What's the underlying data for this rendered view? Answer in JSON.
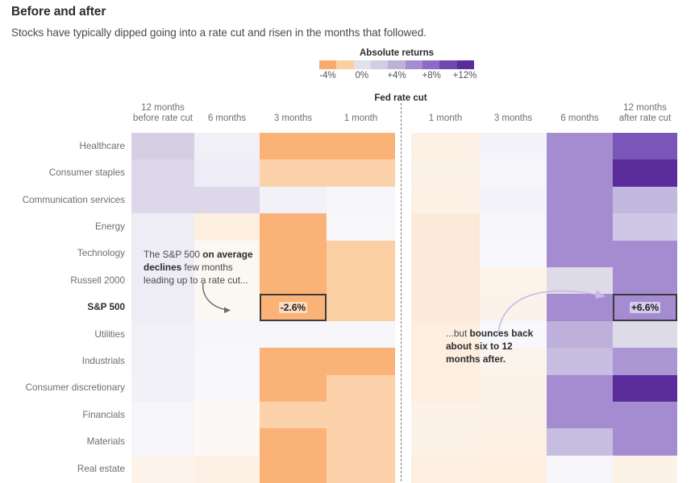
{
  "header": {
    "title": "Before and after",
    "subtitle": "Stocks have typically dipped going into a rate cut and risen in the months that followed."
  },
  "legend": {
    "title": "Absolute returns",
    "swatches": [
      "#f8ac6b",
      "#fbcfa4",
      "#e2e0ea",
      "#d3cde4",
      "#bdb0da",
      "#a58cd0",
      "#8d6bc4",
      "#6f49b0",
      "#5b2d9c"
    ],
    "ticks": [
      {
        "label": "-4%",
        "pos_pct": 5.5
      },
      {
        "label": "0%",
        "pos_pct": 27.5
      },
      {
        "label": "+4%",
        "pos_pct": 50.0
      },
      {
        "label": "+8%",
        "pos_pct": 72.5
      },
      {
        "label": "+12%",
        "pos_pct": 94.0
      }
    ]
  },
  "chart_data": {
    "type": "heatmap",
    "title": "Before and after",
    "subtitle": "Stocks have typically dipped going into a rate cut and risen in the months that followed.",
    "colorbar_label": "Absolute returns",
    "divider_label": "Fed rate cut",
    "xlabel": "",
    "ylabel": "",
    "categories": [
      "12 months\nbefore rate cut",
      "6 months",
      "3 months",
      "1 month",
      "1 month",
      "3 months",
      "6 months",
      "12 months\nafter rate cut"
    ],
    "column_headers": [
      {
        "line1": "12 months",
        "line2": "before rate cut"
      },
      {
        "line1": "6 months",
        "line2": ""
      },
      {
        "line1": "3 months",
        "line2": ""
      },
      {
        "line1": "1 month",
        "line2": ""
      },
      {
        "line1": "1 month",
        "line2": ""
      },
      {
        "line1": "3 months",
        "line2": ""
      },
      {
        "line1": "6 months",
        "line2": ""
      },
      {
        "line1": "12 months",
        "line2": "after rate cut"
      }
    ],
    "rows": [
      "Healthcare",
      "Consumer staples",
      "Communication services",
      "Energy",
      "Technology",
      "Russell 2000",
      "S&P 500",
      "Utilities",
      "Industrials",
      "Consumer discretionary",
      "Financials",
      "Materials",
      "Real estate"
    ],
    "emphasized_row": "S&P 500",
    "colors": [
      [
        "#d6cfe3",
        "#f1f0f7",
        "#fbb277",
        "#fbb277",
        "#fdf0e4",
        "#f4f3f9",
        "#a58cd0",
        "#7a56b8"
      ],
      [
        "#dcd7e9",
        "#eeecf6",
        "#fcd2ab",
        "#fcd2ab",
        "#fbf1e6",
        "#f7f6fb",
        "#a58cd0",
        "#5b2d9c"
      ],
      [
        "#dcd7e9",
        "#dcd7e9",
        "#f2f1f8",
        "#f7f7fb",
        "#fdf0e4",
        "#f4f3f9",
        "#a58cd0",
        "#c3b8de"
      ],
      [
        "#eeedf5",
        "#fdefdf",
        "#fbb277",
        "#f8f8fb",
        "#fbe9da",
        "#f6f5fa",
        "#a58cd0",
        "#cfc7e5"
      ],
      [
        "#eeedf5",
        "#fbf7f3",
        "#fbb277",
        "#fbcfa4",
        "#fbe9da",
        "#f8f7fb",
        "#a58cd0",
        "#a58cd0"
      ],
      [
        "#eeedf5",
        "#fbf7f3",
        "#fbb277",
        "#fbcfa4",
        "#fbe9da",
        "#fdf3e8",
        "#dedbe9",
        "#a58cd0"
      ],
      [
        "#eeedf5",
        "#fbf7f3",
        "#fbb277",
        "#fbcfa4",
        "#fbe9da",
        "#fbf3ea",
        "#a58cd0",
        "#a58cd0"
      ],
      [
        "#f1f0f7",
        "#f7f6fa",
        "#f7f7fb",
        "#f7f7fb",
        "#fdeee0",
        "#f8f8fc",
        "#bdb0da",
        "#dedbe9"
      ],
      [
        "#f1f0f7",
        "#f8f7fb",
        "#fbb277",
        "#fbb277",
        "#fdeee0",
        "#fbf4ec",
        "#c6bde1",
        "#ac95d3"
      ],
      [
        "#f2f1f8",
        "#f8f7fb",
        "#fbb277",
        "#fcd2ab",
        "#fdeee0",
        "#fdf2e7",
        "#a58cd0",
        "#5b2d9c"
      ],
      [
        "#f6f5fa",
        "#fbf8f5",
        "#fcd2ab",
        "#fcd2ab",
        "#fdf2e7",
        "#fbf1e6",
        "#a58cd0",
        "#a58cd0"
      ],
      [
        "#f6f5fa",
        "#fbf8f5",
        "#fbb277",
        "#fcd2ab",
        "#fdf2e7",
        "#fdf0e4",
        "#c6bde1",
        "#a58cd0"
      ],
      [
        "#fdf3ea",
        "#fdf0e4",
        "#fbb277",
        "#fcd2ab",
        "#fdefe2",
        "#fdeee0",
        "#f6f5fa",
        "#fdf2e7"
      ]
    ],
    "highlights": [
      {
        "row": "S&P 500",
        "col": "3 months before",
        "value": "-2.6%"
      },
      {
        "row": "S&P 500",
        "col": "12 months after",
        "value": "+6.6%"
      }
    ]
  },
  "annotations": [
    {
      "id": "left",
      "segments": [
        {
          "text": "The S&P 500 ",
          "bold": false
        },
        {
          "text": "on average declines",
          "bold": true
        },
        {
          "text": " few months leading up to a rate cut...",
          "bold": false
        }
      ],
      "plain": "The S&P 500 on average declines few months leading up to a rate cut..."
    },
    {
      "id": "right",
      "segments": [
        {
          "text": "...but ",
          "bold": false
        },
        {
          "text": "bounces back about six to 12 months after.",
          "bold": true
        }
      ],
      "plain": "...but bounces back about six to 12 months after."
    }
  ]
}
